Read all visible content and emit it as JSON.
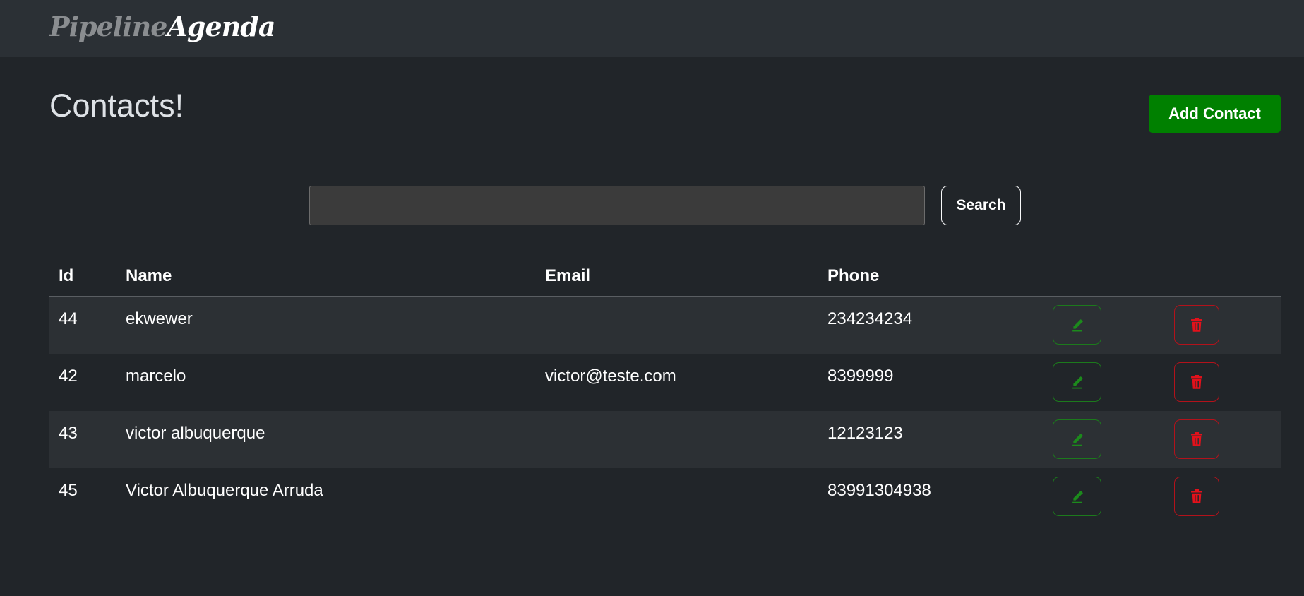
{
  "brand": {
    "part1": "Pipeline",
    "part2": "Agenda"
  },
  "page": {
    "title": "Contacts!"
  },
  "actions": {
    "add_contact_label": "Add Contact",
    "search_label": "Search"
  },
  "search": {
    "value": "",
    "placeholder": ""
  },
  "table": {
    "headers": {
      "id": "Id",
      "name": "Name",
      "email": "Email",
      "phone": "Phone"
    },
    "rows": [
      {
        "id": "44",
        "name": "ekwewer",
        "email": "",
        "phone": "234234234"
      },
      {
        "id": "42",
        "name": "marcelo",
        "email": "victor@teste.com",
        "phone": "8399999"
      },
      {
        "id": "43",
        "name": "victor albuquerque",
        "email": "",
        "phone": "12123123"
      },
      {
        "id": "45",
        "name": "Victor Albuquerque Arruda",
        "email": "",
        "phone": "83991304938"
      }
    ]
  },
  "icons": {
    "edit": "pencil-icon",
    "delete": "trash-icon"
  },
  "colors": {
    "background": "#212529",
    "navbar": "#2b3035",
    "add_button": "#008000",
    "edit_accent": "#1c7a1c",
    "delete_accent": "#e3111b"
  }
}
